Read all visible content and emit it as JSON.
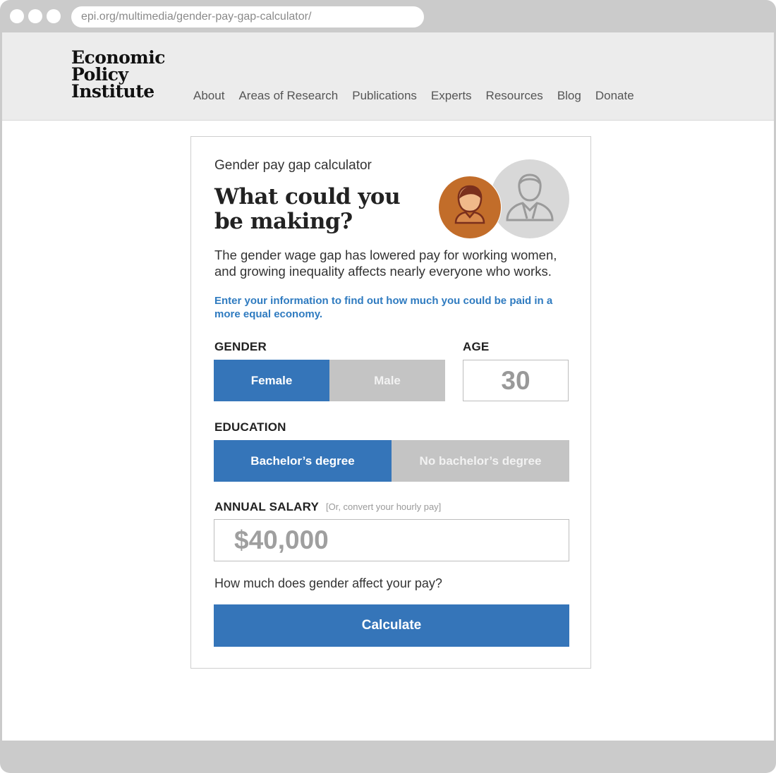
{
  "browser": {
    "url": "epi.org/multimedia/gender-pay-gap-calculator/"
  },
  "site": {
    "logo_lines": [
      "Economic",
      "Policy",
      "Institute"
    ],
    "nav": [
      "About",
      "Areas of Research",
      "Publications",
      "Experts",
      "Resources",
      "Blog",
      "Donate"
    ]
  },
  "calculator": {
    "kicker": "Gender pay gap calculator",
    "headline": "What could you be making?",
    "intro": "The gender wage gap has lowered pay for working women, and growing inequality affects nearly everyone who works.",
    "prompt": "Enter your information to find out how much you could be paid in a more equal economy.",
    "gender": {
      "label": "GENDER",
      "options": [
        "Female",
        "Male"
      ],
      "selected": "Female"
    },
    "age": {
      "label": "AGE",
      "value": "30"
    },
    "education": {
      "label": "EDUCATION",
      "options": [
        "Bachelor’s degree",
        "No bachelor’s degree"
      ],
      "selected": "Bachelor’s degree"
    },
    "salary": {
      "label": "ANNUAL SALARY",
      "hint": "[Or, convert your hourly pay]",
      "value": "$40,000"
    },
    "question": "How much does gender affect your pay?",
    "button": "Calculate"
  },
  "colors": {
    "accent": "#3575b9",
    "inactive": "#c4c4c4",
    "female_avatar": "#c26d2a",
    "male_avatar": "#d8d8d8",
    "link": "#2f7bc0"
  }
}
